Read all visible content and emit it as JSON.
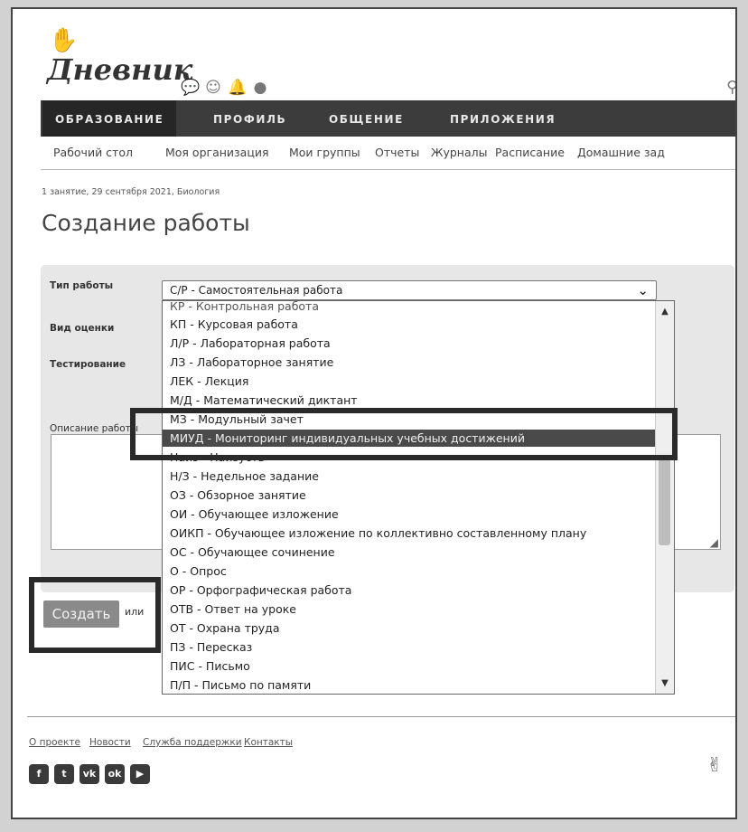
{
  "header": {
    "logo_text": "Дневник",
    "icons": [
      "chat-icon",
      "user-icon",
      "bell-icon",
      "globe-icon",
      "search-icon"
    ]
  },
  "main_nav": [
    {
      "label": "ОБРАЗОВАНИЕ",
      "active": true
    },
    {
      "label": "ПРОФИЛЬ",
      "active": false
    },
    {
      "label": "ОБЩЕНИЕ",
      "active": false
    },
    {
      "label": "ПРИЛОЖЕНИЯ",
      "active": false
    }
  ],
  "sub_nav": [
    "Рабочий стол",
    "Моя организация",
    "Мои группы",
    "Отчеты",
    "Журналы",
    "Расписание",
    "Домашние зад"
  ],
  "breadcrumb": "1 занятие, 29 сентября 2021, Биология",
  "page_title": "Создание работы",
  "form": {
    "labels": {
      "work_type": "Тип работы",
      "grade_type": "Вид оценки",
      "testing": "Тестирование",
      "description": "Описание работы"
    },
    "work_type_value": "С/Р - Самостоятельная работа"
  },
  "dropdown": {
    "options": [
      "КП - Курсовая работа",
      "Л/Р - Лабораторная работа",
      "ЛЗ - Лабораторное занятие",
      "ЛЕК - Лекция",
      "М/Д - Математический диктант",
      "МЗ - Модульный зачет",
      "МИУД - Мониторинг индивидуальных учебных достижений",
      "Наиз - Наизусть",
      "Н/З - Недельное задание",
      "ОЗ - Обзорное занятие",
      "ОИ - Обучающее изложение",
      "ОИКП - Обучающее изложение по коллективно составленному плану",
      "ОС - Обучающее сочинение",
      "О - Опрос",
      "ОР - Орфографическая работа",
      "ОТВ - Ответ на уроке",
      "ОТ - Охрана труда",
      "ПЗ - Пересказ",
      "ПИС - Письмо",
      "П/П - Письмо по памяти"
    ],
    "selected": "МИУД - Мониторинг индивидуальных учебных достижений"
  },
  "actions": {
    "create_label": "Создать",
    "or_label": "или"
  },
  "footer": {
    "links": [
      "О проекте",
      "Новости",
      "Служба поддержки",
      "Контакты"
    ],
    "social": [
      {
        "name": "facebook-icon",
        "glyph": "f"
      },
      {
        "name": "twitter-icon",
        "glyph": "t"
      },
      {
        "name": "vk-icon",
        "glyph": "vk"
      },
      {
        "name": "odnoklassniki-icon",
        "glyph": "ok"
      },
      {
        "name": "youtube-icon",
        "glyph": "▶"
      }
    ]
  }
}
